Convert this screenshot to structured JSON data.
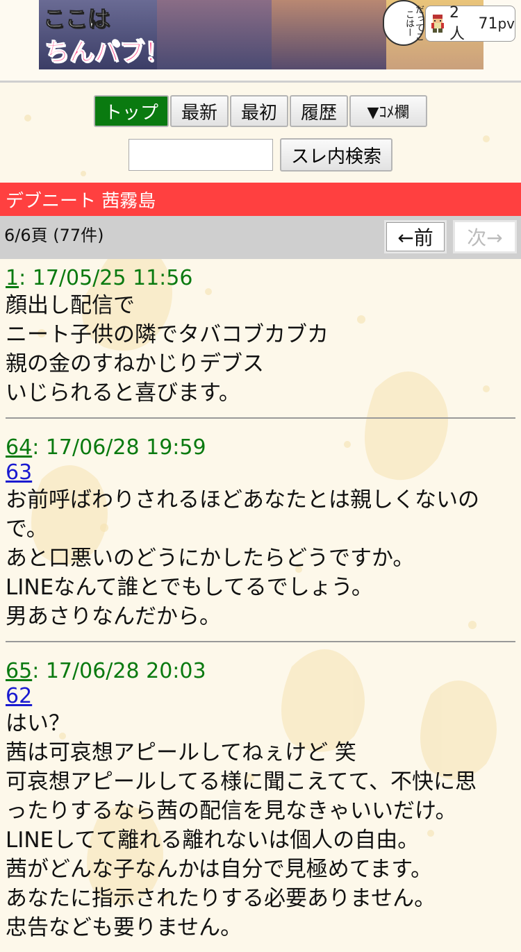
{
  "banner": {
    "line1": "ここは",
    "line2": "ちんパブ！",
    "bubble": "だってここはー",
    "users": "2人",
    "pv_value": "71",
    "pv_unit": "pv"
  },
  "nav": {
    "items": [
      {
        "label": "トップ"
      },
      {
        "label": "最新"
      },
      {
        "label": "最初"
      },
      {
        "label": "履歴"
      },
      {
        "label": "▼ｺﾒ欄"
      }
    ]
  },
  "search": {
    "value": "",
    "button": "スレ内検索"
  },
  "thread": {
    "title": "デブニート 茜霧島"
  },
  "pager": {
    "count": "6/6頁 (77件)",
    "prev": "←前",
    "next": "次→"
  },
  "posts": [
    {
      "num": "1",
      "date": ": 17/05/25 11:56",
      "anchor": "",
      "lines": [
        "顔出し配信で",
        "ニート子供の隣でタバコブカブカ",
        "親の金のすねかじりデブス",
        "いじられると喜びます。"
      ]
    },
    {
      "num": "64",
      "date": ": 17/06/28 19:59",
      "anchor": "63",
      "lines": [
        "お前呼ばわりされるほどあなたとは親しくないの",
        "で。",
        "あと口悪いのどうにかしたらどうですか。",
        "LINEなんて誰とでもしてるでしょう。",
        "男あさりなんだから。"
      ]
    },
    {
      "num": "65",
      "date": ": 17/06/28 20:03",
      "anchor": "62",
      "lines": [
        "はい？",
        "茜は可哀想アピールしてねぇけど 笑",
        "可哀想アピールしてる様に聞こえてて、不快に思",
        "ったりするなら茜の配信を見なきゃいいだけ。",
        "LINEしてて離れる離れないは個人の自由。",
        "茜がどんな子なんかは自分で見極めてます。",
        "あなたに指示されたりする必要ありません。",
        "忠告なども要りません。"
      ]
    }
  ]
}
